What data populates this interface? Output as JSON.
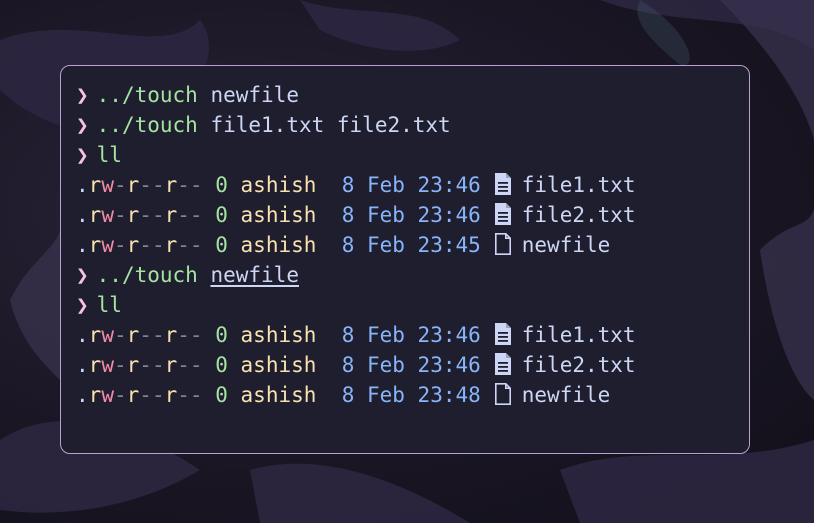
{
  "prompt_symbol": "❯",
  "colors": {
    "terminal_bg": "#1e1e2e",
    "border": "#b7a2cf",
    "prompt": "#f5c2e7",
    "command": "#a6e3a1",
    "user": "#f9e2af",
    "date": "#89b4fa"
  },
  "lines": [
    {
      "type": "cmd",
      "cmd": "../touch",
      "args": "newfile",
      "underline": false
    },
    {
      "type": "cmd",
      "cmd": "../touch",
      "args": "file1.txt file2.txt",
      "underline": false
    },
    {
      "type": "cmd",
      "cmd": "ll",
      "args": "",
      "underline": false
    },
    {
      "type": "entry",
      "perm": ".rw-r--r--",
      "size": "0",
      "user": "ashish",
      "date": " 8 Feb 23:46",
      "icon": "text-file-icon",
      "name": "file1.txt"
    },
    {
      "type": "entry",
      "perm": ".rw-r--r--",
      "size": "0",
      "user": "ashish",
      "date": " 8 Feb 23:46",
      "icon": "text-file-icon",
      "name": "file2.txt"
    },
    {
      "type": "entry",
      "perm": ".rw-r--r--",
      "size": "0",
      "user": "ashish",
      "date": " 8 Feb 23:45",
      "icon": "empty-file-icon",
      "name": "newfile"
    },
    {
      "type": "cmd",
      "cmd": "../touch",
      "args": "newfile",
      "underline": true
    },
    {
      "type": "cmd",
      "cmd": "ll",
      "args": "",
      "underline": false
    },
    {
      "type": "entry",
      "perm": ".rw-r--r--",
      "size": "0",
      "user": "ashish",
      "date": " 8 Feb 23:46",
      "icon": "text-file-icon",
      "name": "file1.txt"
    },
    {
      "type": "entry",
      "perm": ".rw-r--r--",
      "size": "0",
      "user": "ashish",
      "date": " 8 Feb 23:46",
      "icon": "text-file-icon",
      "name": "file2.txt"
    },
    {
      "type": "entry",
      "perm": ".rw-r--r--",
      "size": "0",
      "user": "ashish",
      "date": " 8 Feb 23:48",
      "icon": "empty-file-icon",
      "name": "newfile"
    }
  ]
}
